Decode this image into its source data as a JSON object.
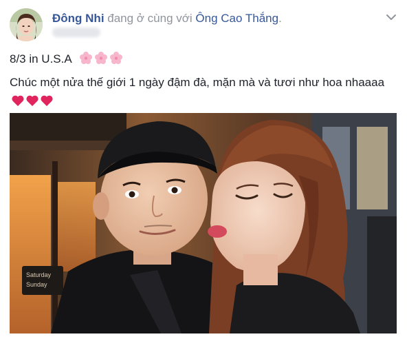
{
  "post": {
    "author": "Đông Nhi",
    "verb": " đang ở cùng với ",
    "tagged": "Ông Cao Thắng",
    "tagged_suffix": ".",
    "line1": "8/3 in U.S.A",
    "line2": "Chúc một nửa thế giới 1 ngày đậm đà, mặn mà và tươi như hoa nhaaaa",
    "flower_icons": [
      "cherry-blossom",
      "cherry-blossom",
      "cherry-blossom"
    ],
    "heart_icons": [
      "heart",
      "heart",
      "heart"
    ],
    "colors": {
      "link": "#365899",
      "secondary": "#90949c",
      "text": "#1d2129",
      "heart": "#e0245e",
      "blossom": "#f7b6cc"
    },
    "photo": {
      "sign_line1": "Saturday",
      "sign_line2": "Sunday"
    }
  }
}
